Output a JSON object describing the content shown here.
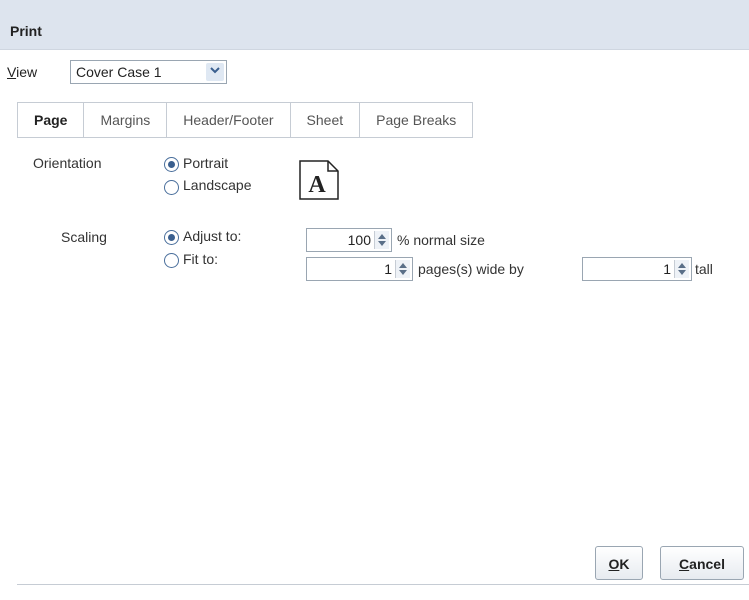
{
  "dialog": {
    "title": "Print"
  },
  "view": {
    "label_accel": "V",
    "label_rest": "iew",
    "selected": "Cover Case 1"
  },
  "tabs": [
    {
      "label": "Page",
      "active": true
    },
    {
      "label": "Margins",
      "active": false
    },
    {
      "label": "Header/Footer",
      "active": false
    },
    {
      "label": "Sheet",
      "active": false
    },
    {
      "label": "Page Breaks",
      "active": false
    }
  ],
  "orientation": {
    "label": "Orientation",
    "options": [
      {
        "label": "Portrait",
        "checked": true
      },
      {
        "label": "Landscape",
        "checked": false
      }
    ],
    "icon_letter": "A"
  },
  "scaling": {
    "label": "Scaling",
    "adjust": {
      "label": "Adjust to:",
      "checked": true,
      "value": "100",
      "suffix": "% normal size"
    },
    "fit": {
      "label": "Fit to:",
      "checked": false,
      "wide_value": "1",
      "wide_suffix": "pages(s) wide by",
      "tall_value": "1",
      "tall_suffix": "tall"
    }
  },
  "buttons": {
    "ok": {
      "accel": "O",
      "rest": "K"
    },
    "cancel": {
      "accel": "C",
      "rest": "ancel"
    }
  }
}
